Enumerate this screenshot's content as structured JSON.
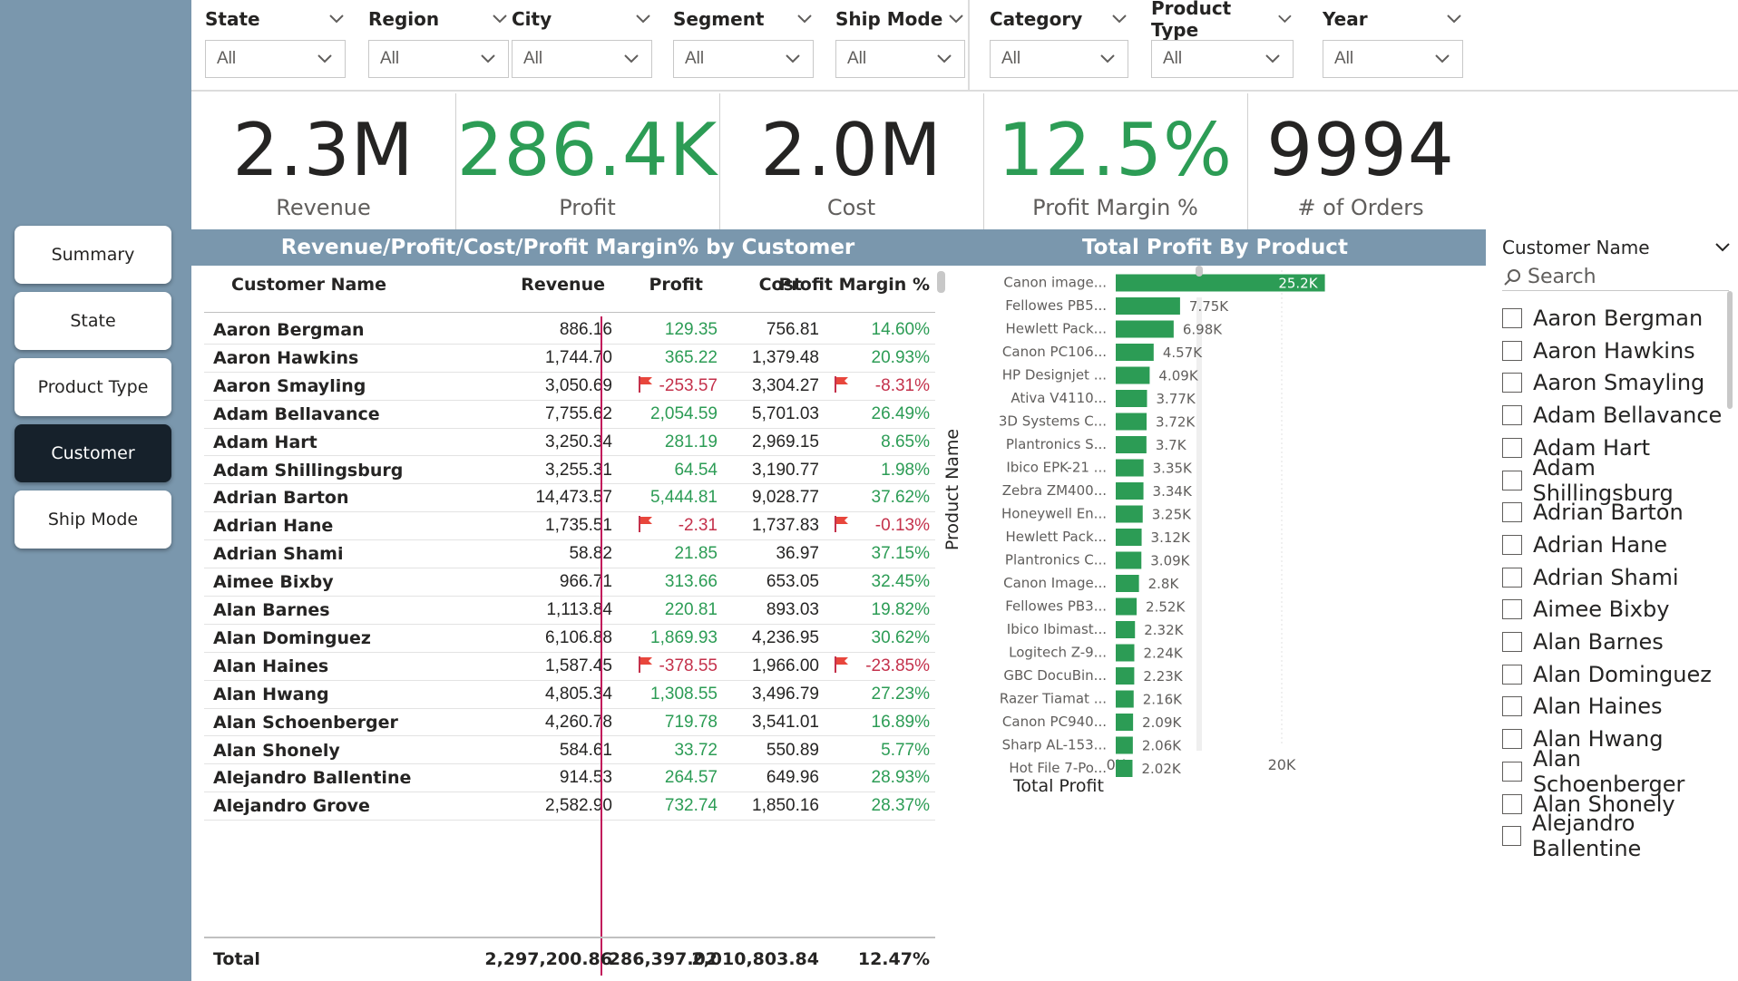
{
  "nav": {
    "items": [
      {
        "label": "Summary",
        "active": false
      },
      {
        "label": "State",
        "active": false
      },
      {
        "label": "Product Type",
        "active": false
      },
      {
        "label": "Customer",
        "active": true
      },
      {
        "label": "Ship Mode",
        "active": false
      }
    ]
  },
  "slicers": [
    {
      "title": "State",
      "value": "All"
    },
    {
      "title": "Region",
      "value": "All"
    },
    {
      "title": "City",
      "value": "All"
    },
    {
      "title": "Segment",
      "value": "All"
    },
    {
      "title": "Ship Mode",
      "value": "All"
    },
    {
      "title": "Category",
      "value": "All"
    },
    {
      "title": "Product Type",
      "value": "All"
    },
    {
      "title": "Year",
      "value": "All"
    }
  ],
  "kpis": [
    {
      "value": "2.3M",
      "label": "Revenue",
      "color": "#252423"
    },
    {
      "value": "286.4K",
      "label": "Profit",
      "color": "#2c9c55"
    },
    {
      "value": "2.0M",
      "label": "Cost",
      "color": "#252423"
    },
    {
      "value": "12.5%",
      "label": "Profit Margin %",
      "color": "#2c9c55"
    },
    {
      "value": "9994",
      "label": "# of Orders",
      "color": "#252423"
    }
  ],
  "table": {
    "title": "Revenue/Profit/Cost/Profit Margin% by Customer",
    "columns": [
      "Customer Name",
      "Revenue",
      "Profit",
      "Cost",
      "Profit Margin %"
    ],
    "rows": [
      {
        "name": "Aaron Bergman",
        "revenue": "886.16",
        "profit": "129.35",
        "cost": "756.81",
        "margin": "14.60%",
        "flag": false
      },
      {
        "name": "Aaron Hawkins",
        "revenue": "1,744.70",
        "profit": "365.22",
        "cost": "1,379.48",
        "margin": "20.93%",
        "flag": false
      },
      {
        "name": "Aaron Smayling",
        "revenue": "3,050.69",
        "profit": "-253.57",
        "cost": "3,304.27",
        "margin": "-8.31%",
        "flag": true
      },
      {
        "name": "Adam Bellavance",
        "revenue": "7,755.62",
        "profit": "2,054.59",
        "cost": "5,701.03",
        "margin": "26.49%",
        "flag": false
      },
      {
        "name": "Adam Hart",
        "revenue": "3,250.34",
        "profit": "281.19",
        "cost": "2,969.15",
        "margin": "8.65%",
        "flag": false
      },
      {
        "name": "Adam Shillingsburg",
        "revenue": "3,255.31",
        "profit": "64.54",
        "cost": "3,190.77",
        "margin": "1.98%",
        "flag": false
      },
      {
        "name": "Adrian Barton",
        "revenue": "14,473.57",
        "profit": "5,444.81",
        "cost": "9,028.77",
        "margin": "37.62%",
        "flag": false
      },
      {
        "name": "Adrian Hane",
        "revenue": "1,735.51",
        "profit": "-2.31",
        "cost": "1,737.83",
        "margin": "-0.13%",
        "flag": true
      },
      {
        "name": "Adrian Shami",
        "revenue": "58.82",
        "profit": "21.85",
        "cost": "36.97",
        "margin": "37.15%",
        "flag": false
      },
      {
        "name": "Aimee Bixby",
        "revenue": "966.71",
        "profit": "313.66",
        "cost": "653.05",
        "margin": "32.45%",
        "flag": false
      },
      {
        "name": "Alan Barnes",
        "revenue": "1,113.84",
        "profit": "220.81",
        "cost": "893.03",
        "margin": "19.82%",
        "flag": false
      },
      {
        "name": "Alan Dominguez",
        "revenue": "6,106.88",
        "profit": "1,869.93",
        "cost": "4,236.95",
        "margin": "30.62%",
        "flag": false
      },
      {
        "name": "Alan Haines",
        "revenue": "1,587.45",
        "profit": "-378.55",
        "cost": "1,966.00",
        "margin": "-23.85%",
        "flag": true
      },
      {
        "name": "Alan Hwang",
        "revenue": "4,805.34",
        "profit": "1,308.55",
        "cost": "3,496.79",
        "margin": "27.23%",
        "flag": false
      },
      {
        "name": "Alan Schoenberger",
        "revenue": "4,260.78",
        "profit": "719.78",
        "cost": "3,541.01",
        "margin": "16.89%",
        "flag": false
      },
      {
        "name": "Alan Shonely",
        "revenue": "584.61",
        "profit": "33.72",
        "cost": "550.89",
        "margin": "5.77%",
        "flag": false
      },
      {
        "name": "Alejandro Ballentine",
        "revenue": "914.53",
        "profit": "264.57",
        "cost": "649.96",
        "margin": "28.93%",
        "flag": false
      },
      {
        "name": "Alejandro Grove",
        "revenue": "2,582.90",
        "profit": "732.74",
        "cost": "1,850.16",
        "margin": "28.37%",
        "flag": false
      }
    ],
    "total": {
      "label": "Total",
      "revenue": "2,297,200.86",
      "profit": "286,397.02",
      "cost": "2,010,803.84",
      "margin": "12.47%"
    }
  },
  "chart_data": {
    "type": "bar",
    "orientation": "horizontal",
    "title": "Total Profit By Product",
    "xlabel": "Total Profit",
    "ylabel": "Product Name",
    "xlim": [
      0,
      25000
    ],
    "xticks": [
      {
        "value": 0,
        "label": "0K"
      },
      {
        "value": 20000,
        "label": "20K"
      }
    ],
    "bar_color": "#2c9c55",
    "categories": [
      "Canon image...",
      "Fellowes PB5...",
      "Hewlett Pack...",
      "Canon PC106...",
      "HP Designjet ...",
      "Ativa V4110...",
      "3D Systems C...",
      "Plantronics S...",
      "Ibico EPK-21 ...",
      "Zebra ZM400...",
      "Honeywell En...",
      "Hewlett Pack...",
      "Plantronics C...",
      "Canon Image...",
      "Fellowes PB3...",
      "Ibico Ibimast...",
      "Logitech Z-9...",
      "GBC DocuBin...",
      "Razer Tiamat ...",
      "Canon PC940...",
      "Sharp AL-153...",
      "Hot File 7-Po..."
    ],
    "values": [
      25200,
      7750,
      6980,
      4570,
      4090,
      3770,
      3720,
      3700,
      3350,
      3340,
      3250,
      3120,
      3090,
      2800,
      2520,
      2320,
      2240,
      2230,
      2160,
      2090,
      2060,
      2020
    ],
    "labels": [
      "25.2K",
      "7.75K",
      "6.98K",
      "4.57K",
      "4.09K",
      "3.77K",
      "3.72K",
      "3.7K",
      "3.35K",
      "3.34K",
      "3.25K",
      "3.12K",
      "3.09K",
      "2.8K",
      "2.52K",
      "2.32K",
      "2.24K",
      "2.23K",
      "2.16K",
      "2.09K",
      "2.06K",
      "2.02K"
    ]
  },
  "customer_slicer": {
    "title": "Customer Name",
    "search_placeholder": "Search",
    "items": [
      "Aaron Bergman",
      "Aaron Hawkins",
      "Aaron Smayling",
      "Adam Bellavance",
      "Adam Hart",
      "Adam Shillingsburg",
      "Adrian Barton",
      "Adrian Hane",
      "Adrian Shami",
      "Aimee Bixby",
      "Alan Barnes",
      "Alan Dominguez",
      "Alan Haines",
      "Alan Hwang",
      "Alan Schoenberger",
      "Alan Shonely",
      "Alejandro Ballentine"
    ]
  },
  "icons": {
    "chevron": "chevron-down-icon",
    "flag": "flag-icon",
    "search": "search-icon",
    "checkbox": "checkbox-icon"
  },
  "colors": {
    "nav_bg": "#7a97ad",
    "active_nav": "#16212b",
    "positive": "#2c9c55",
    "negative": "#c4314b",
    "flag": "#e8463c"
  }
}
